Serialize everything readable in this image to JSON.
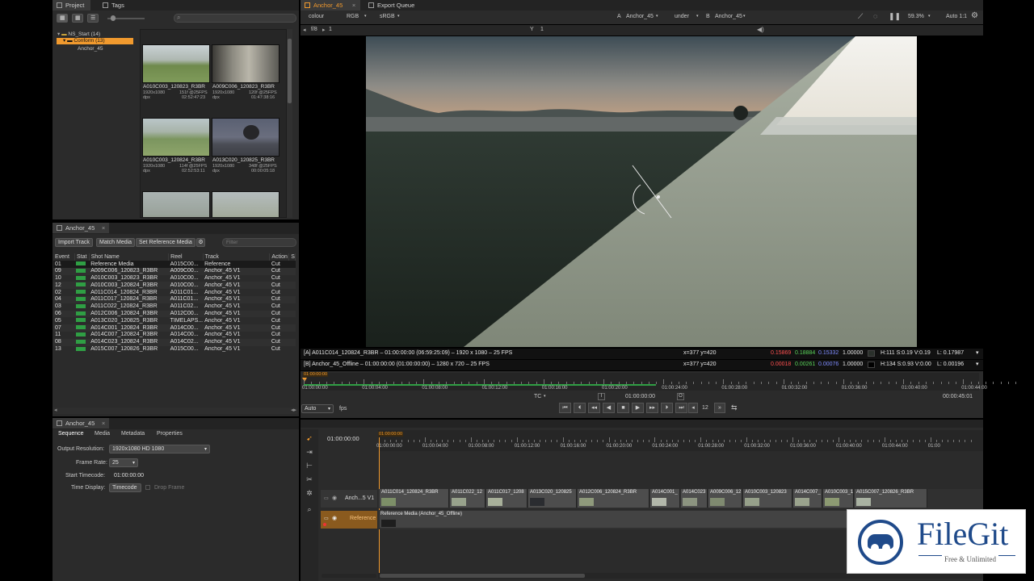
{
  "project_panel": {
    "tabs": [
      {
        "label": "Project"
      },
      {
        "label": "Tags"
      }
    ],
    "tree": {
      "root": "NS_Start (14)",
      "folder": "Conform (13)",
      "item": "Anchor_45"
    },
    "thumbnails": [
      {
        "name": "A010C003_120823_R3BR",
        "res": "1920x1080",
        "fps": "151f @25FPS",
        "fmt": "dpx",
        "tc": "02:52:47:23"
      },
      {
        "name": "A009C006_120823_R3BR",
        "res": "1920x1080",
        "fps": "120f @25FPS",
        "fmt": "dpx",
        "tc": "01:47:38:16"
      },
      {
        "name": "A010C003_120824_R3BR",
        "res": "1920x1080",
        "fps": "114f @25FPS",
        "fmt": "dpx",
        "tc": "02:52:53:11"
      },
      {
        "name": "A013C020_120825_R3BR",
        "res": "1920x1080",
        "fps": "348f @25FPS",
        "fmt": "dpx",
        "tc": "00:00:05:18"
      }
    ]
  },
  "event_panel": {
    "tab": "Anchor_45",
    "buttons": {
      "import": "Import Track",
      "match": "Match Media",
      "setref": "Set Reference Media"
    },
    "filter_placeholder": "Filter",
    "columns": [
      "Event",
      "Stat",
      "Shot Name",
      "Reel",
      "Track",
      "Action",
      "S"
    ],
    "rows": [
      {
        "event": "01",
        "shot": "Reference Media",
        "reel": "A015C00...",
        "track": "Reference",
        "action": "Cut"
      },
      {
        "event": "09",
        "shot": "A009C006_120823_R3BR",
        "reel": "A009C00...",
        "track": "Anchor_45 V1",
        "action": "Cut"
      },
      {
        "event": "10",
        "shot": "A010C003_120823_R3BR",
        "reel": "A010C00...",
        "track": "Anchor_45 V1",
        "action": "Cut"
      },
      {
        "event": "12",
        "shot": "A010C003_120824_R3BR",
        "reel": "A010C00...",
        "track": "Anchor_45 V1",
        "action": "Cut"
      },
      {
        "event": "02",
        "shot": "A011C014_120824_R3BR",
        "reel": "A011C01...",
        "track": "Anchor_45 V1",
        "action": "Cut"
      },
      {
        "event": "04",
        "shot": "A011C017_120824_R3BR",
        "reel": "A011C01...",
        "track": "Anchor_45 V1",
        "action": "Cut"
      },
      {
        "event": "03",
        "shot": "A011C022_120824_R3BR",
        "reel": "A011C02...",
        "track": "Anchor_45 V1",
        "action": "Cut"
      },
      {
        "event": "06",
        "shot": "A012C006_120824_R3BR",
        "reel": "A012C00...",
        "track": "Anchor_45 V1",
        "action": "Cut"
      },
      {
        "event": "05",
        "shot": "A013C020_120825_R3BR",
        "reel": "TIMELAPS...",
        "track": "Anchor_45 V1",
        "action": "Cut"
      },
      {
        "event": "07",
        "shot": "A014C001_120824_R3BR",
        "reel": "A014C00...",
        "track": "Anchor_45 V1",
        "action": "Cut"
      },
      {
        "event": "11",
        "shot": "A014C007_120824_R3BR",
        "reel": "A014C00...",
        "track": "Anchor_45 V1",
        "action": "Cut"
      },
      {
        "event": "08",
        "shot": "A014C023_120824_R3BR",
        "reel": "A014C02...",
        "track": "Anchor_45 V1",
        "action": "Cut"
      },
      {
        "event": "13",
        "shot": "A015C007_120826_R3BR",
        "reel": "A015C00...",
        "track": "Anchor_45 V1",
        "action": "Cut"
      }
    ]
  },
  "viewer": {
    "tabs": [
      {
        "label": "Anchor_45"
      },
      {
        "label": "Export Queue"
      }
    ],
    "toolbar": {
      "colour": "colour",
      "rgb": "RGB",
      "srgb": "sRGB",
      "a_label": "A",
      "a_value": "Anchor_45",
      "blend": "under",
      "b_label": "B",
      "b_value": "Anchor_45",
      "zoom": "59.3%",
      "auto": "Auto 1:1"
    },
    "subbar": {
      "fstop": "f/8",
      "frame": "1",
      "y_label": "Y",
      "y_value": "1"
    },
    "info_a": {
      "text": "[A] A011C014_120824_R3BR – 01:00:00:00 (06:59:25:09) – 1920 x 1080 – 25 FPS",
      "coords": "x=377 y=420",
      "r": "0.15869",
      "g": "0.18884",
      "b": "0.15332",
      "a": "1.00000",
      "hsv": "H:111 S:0.19 V:0.19",
      "l": "L: 0.17987"
    },
    "info_b": {
      "text": "[B] Anchor_45_Offline – 01:00:00:00 (01:00:00:00) – 1280 x 720 – 25 FPS",
      "coords": "x=377 y=420",
      "r": "0.00018",
      "g": "0.00261",
      "b": "0.00076",
      "a": "1.00000",
      "hsv": "H:134 S:0.93 V:0.00",
      "l": "L: 0.00196"
    },
    "ruler_marker": "01:00:00:00",
    "ruler_ticks": [
      "01:00:00:00",
      "01:00:04:00",
      "01:00:08:00",
      "01:00:12:00",
      "01:00:16:00",
      "01:00:20:00",
      "01:00:24:00",
      "01:00:28:00",
      "01:00:32:00",
      "01:00:36:00",
      "01:00:40:00",
      "01:00:44:00"
    ],
    "tc_mode": "TC",
    "current_tc": "01:00:00:00",
    "duration": "00:00:45:01",
    "fps_mode": "Auto",
    "fps_label": "fps",
    "step": "12"
  },
  "sequence_panel": {
    "tab": "Anchor_45",
    "subtabs": [
      "Sequence",
      "Media",
      "Metadata",
      "Properties"
    ],
    "output_res_label": "Output Resolution:",
    "output_res_value": "1920x1080 HD 1080",
    "frame_rate_label": "Frame Rate:",
    "frame_rate_value": "25",
    "start_tc_label": "Start Timecode:",
    "start_tc_value": "01:00:00:00",
    "time_display_label": "Time Display:",
    "time_display_value": "Timecode",
    "drop_frame_label": "Drop Frame"
  },
  "timeline": {
    "current_tc": "01:00:00:00",
    "marker": "01:00:00:00",
    "ticks": [
      "01:00:00:00",
      "01:00:04:00",
      "01:00:08:00",
      "01:00:12:00",
      "01:00:16:00",
      "01:00:20:00",
      "01:00:24:00",
      "01:00:28:00",
      "01:00:32:00",
      "01:00:36:00",
      "01:00:40:00",
      "01:00:44:00",
      "01:00"
    ],
    "track_v1": "Anch...5 V1",
    "track_ref": "Reference",
    "clips": [
      {
        "label": "A011C014_120824_R3BR"
      },
      {
        "label": "A011C022_12"
      },
      {
        "label": "A011C017_1208"
      },
      {
        "label": "A013C020_120825"
      },
      {
        "label": "A012C006_120824_R3BR"
      },
      {
        "label": "A014C001_"
      },
      {
        "label": "A014C023"
      },
      {
        "label": "A009C006_12"
      },
      {
        "label": "A010C003_120823"
      },
      {
        "label": "A014C007_"
      },
      {
        "label": "A010C003_1"
      },
      {
        "label": "A015C007_120826_R3BR"
      }
    ],
    "ref_clip": "Reference Media (Anchor_45_Offline)"
  },
  "watermark": {
    "brand": "FileGit",
    "tagline": "Free & Unlimited"
  },
  "colors": {
    "accent": "#f19a2e",
    "stat_green": "#2f9e44"
  }
}
